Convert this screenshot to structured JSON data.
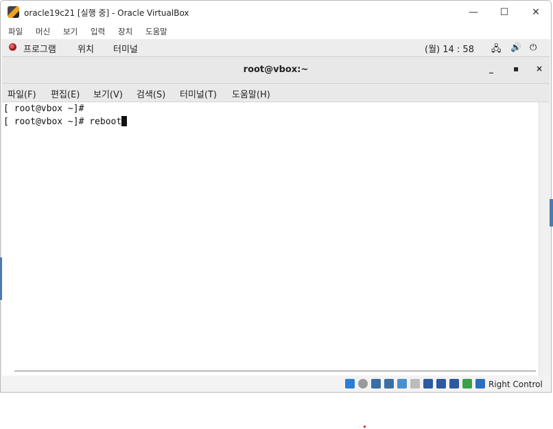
{
  "window": {
    "title": "oracle19c21 [실행 중] - Oracle VirtualBox",
    "minimize": "—",
    "maximize": "☐",
    "close": "✕"
  },
  "vbox_menu": [
    "파일",
    "머신",
    "보기",
    "입력",
    "장치",
    "도움말"
  ],
  "gnome_bar": {
    "apps": "프로그램",
    "places": "위치",
    "terminal": "터미널",
    "clock": "(월) 14 : 58",
    "icons": [
      "network-icon",
      "volume-icon",
      "power-icon"
    ]
  },
  "terminal": {
    "title": "root@vbox:~",
    "minimize": "_",
    "maximize": "▪",
    "close": "×",
    "menu": [
      "파일(F)",
      "편집(E)",
      "보기(V)",
      "검색(S)",
      "터미널(T)",
      "도움말(H)"
    ],
    "lines": [
      "[ root@vbox ~]# ",
      "[ root@vbox ~]# reboot"
    ]
  },
  "statusbar": {
    "host_key": "Right Control",
    "icon_colors": [
      "#2a7fd4",
      "#9a9a9a",
      "#3a6ea5",
      "#3a6ea5",
      "#4a8fd0",
      "#bcbcbc",
      "#2c5aa0",
      "#2c5aa0",
      "#2c5aa0",
      "#3aa04a",
      "#2a6fc0"
    ]
  }
}
